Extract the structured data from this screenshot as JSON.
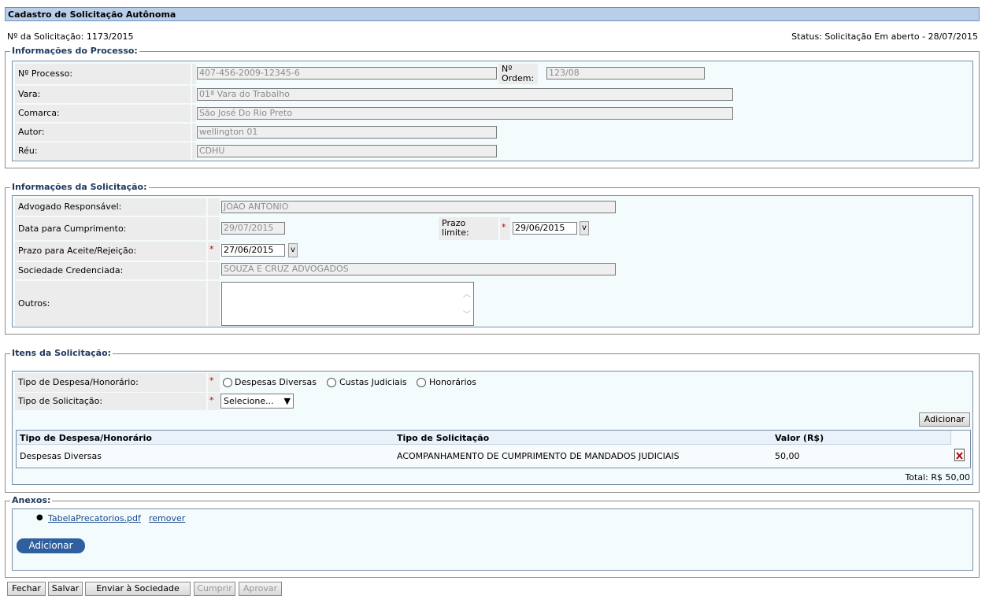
{
  "page": {
    "title": "Cadastro de Solicitação Autônoma"
  },
  "header": {
    "solicitacao": "Nº da Solicitação: 1173/2015",
    "status": "Status: Solicitação Em aberto - 28/07/2015"
  },
  "processo": {
    "legend": "Informações do Processo:",
    "processo_label": "Nº Processo:",
    "processo_value": "407-456-2009-12345-6",
    "ordem_label_1": "Nº",
    "ordem_label_2": "Ordem:",
    "ordem_value": "123/08",
    "vara_label": "Vara:",
    "vara_value": "01ª Vara do Trabalho",
    "comarca_label": "Comarca:",
    "comarca_value": "São José Do Rio Preto",
    "autor_label": "Autor:",
    "autor_value": "wellington 01",
    "reu_label": "Réu:",
    "reu_value": "CDHU"
  },
  "solicitacao": {
    "legend": "Informações da Solicitação:",
    "advogado_label": "Advogado Responsável:",
    "advogado_value": "JOAO ANTONIO",
    "data_label": "Data para Cumprimento:",
    "data_value": "29/07/2015",
    "prazo_limite_label_1": "Prazo",
    "prazo_limite_label_2": "limite:",
    "prazo_limite_value": "29/06/2015",
    "prazo_aceite_label": "Prazo para Aceite/Rejeição:",
    "prazo_aceite_value": "27/06/2015",
    "sociedade_label": "Sociedade Credenciada:",
    "sociedade_value": "SOUZA E CRUZ ADVOGADOS",
    "outros_label": "Outros:",
    "outros_value": "",
    "cal_button": "v",
    "required_mark": "*"
  },
  "itens": {
    "legend": "Itens da Solicitação:",
    "tipo_despesa_label": "Tipo de Despesa/Honorário:",
    "radio_options": [
      "Despesas Diversas",
      "Custas Judiciais",
      "Honorários"
    ],
    "tipo_solicitacao_label": "Tipo de Solicitação:",
    "tipo_solicitacao_selected": "Selecione...",
    "add_button": "Adicionar",
    "columns": [
      "Tipo de Despesa/Honorário",
      "Tipo de Solicitação",
      "Valor (R$)"
    ],
    "rows": [
      {
        "tipo": "Despesas Diversas",
        "solicitacao": "ACOMPANHAMENTO DE CUMPRIMENTO DE MANDADOS JUDICIAIS",
        "valor": "50,00"
      }
    ],
    "total": "Total: R$ 50,00"
  },
  "anexos": {
    "legend": "Anexos:",
    "file_name": "TabelaPrecatorios.pdf",
    "remove_link": "remover",
    "add_button": "Adicionar"
  },
  "footer": {
    "buttons": [
      "Fechar",
      "Salvar",
      "Enviar à Sociedade",
      "Cumprir",
      "Aprovar"
    ]
  },
  "colors": {
    "title_bg": "#b9cfe9",
    "panel_bg": "#f3fbfd",
    "primary_button": "#2f5f9e",
    "required": "#b00000"
  }
}
